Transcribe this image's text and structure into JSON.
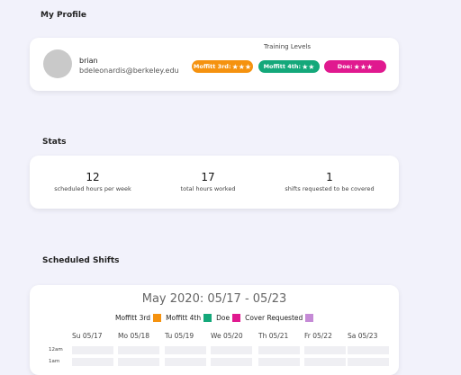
{
  "profile": {
    "section_title": "My Profile",
    "name": "brian",
    "email": "bdeleonardis@berkeley.edu",
    "training_title": "Training Levels",
    "badges": [
      {
        "label": "Moffitt 3rd:",
        "stars": "★★★",
        "color": "#f5920f"
      },
      {
        "label": "Moffitt 4th:",
        "stars": "★★",
        "color": "#14a87a"
      },
      {
        "label": "Doe:",
        "stars": "★★★",
        "color": "#e0198f"
      }
    ]
  },
  "stats": {
    "section_title": "Stats",
    "items": [
      {
        "value": "12",
        "label": "scheduled hours per week"
      },
      {
        "value": "17",
        "label": "total hours worked"
      },
      {
        "value": "1",
        "label": "shifts requested to be covered"
      }
    ]
  },
  "schedule": {
    "section_title": "Scheduled Shifts",
    "title": "May 2020: 05/17 - 05/23",
    "legend": [
      {
        "label": "Moffitt 3rd",
        "color": "#f5920f"
      },
      {
        "label": "Moffitt 4th",
        "color": "#14a87a"
      },
      {
        "label": "Doe",
        "color": "#e0198f"
      },
      {
        "label": "Cover Requested",
        "color": "#c58ad6"
      }
    ],
    "days": [
      "Su 05/17",
      "Mo 05/18",
      "Tu 05/19",
      "We 05/20",
      "Th 05/21",
      "Fr 05/22",
      "Sa 05/23"
    ],
    "hours": [
      "12am",
      "1am"
    ]
  }
}
